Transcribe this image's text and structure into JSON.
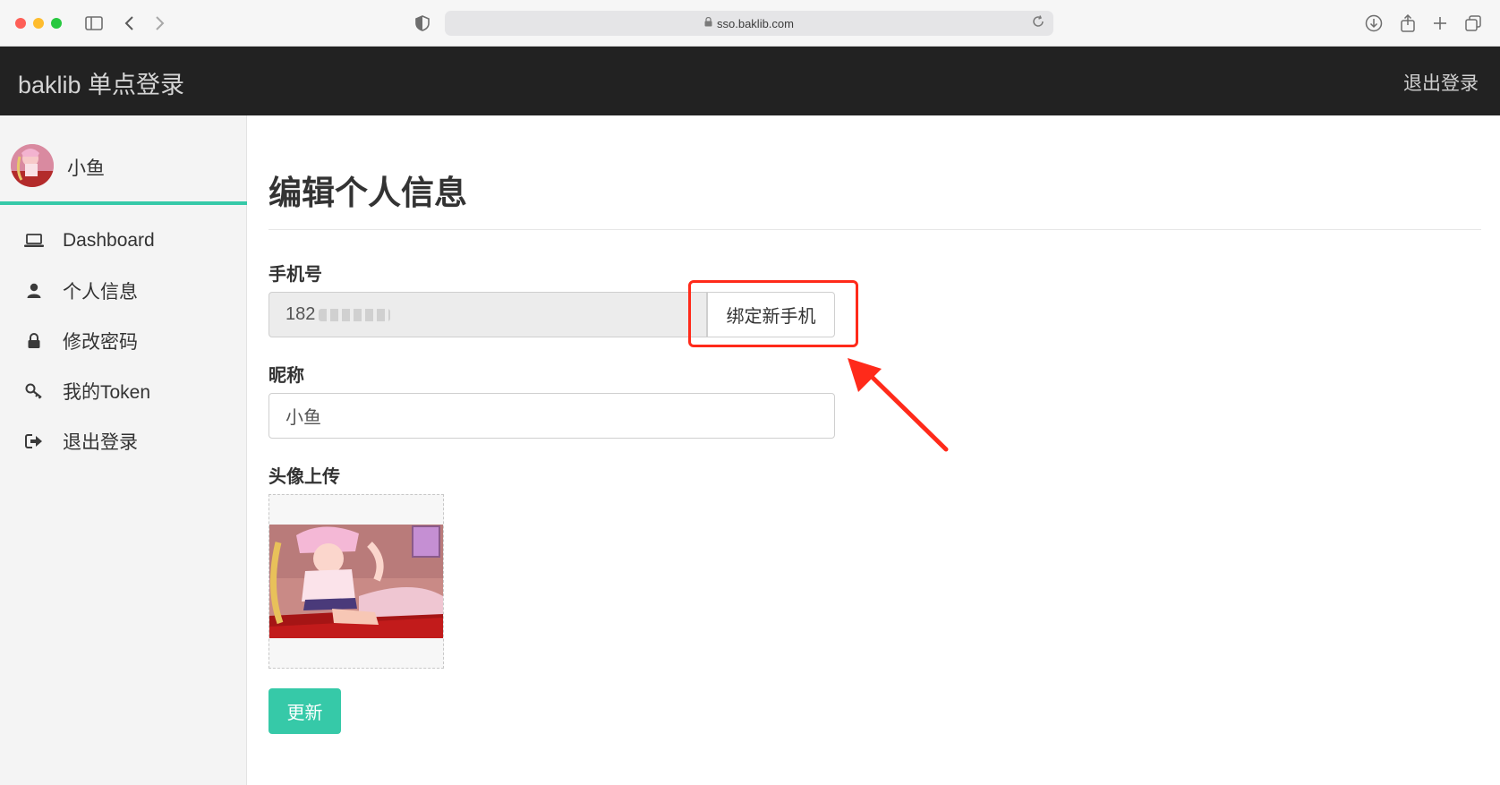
{
  "browser": {
    "url": "sso.baklib.com",
    "icons": [
      "sidebar-toggle-icon",
      "back-icon",
      "forward-icon",
      "privacy-shield-icon",
      "download-icon",
      "share-icon",
      "new-tab-icon",
      "tabs-overview-icon"
    ]
  },
  "header": {
    "brand": "baklib 单点登录",
    "logout_label": "退出登录"
  },
  "sidebar": {
    "user_name": "小鱼",
    "items": [
      {
        "label": "Dashboard",
        "icon": "laptop-icon"
      },
      {
        "label": "个人信息",
        "icon": "user-icon"
      },
      {
        "label": "修改密码",
        "icon": "lock-icon"
      },
      {
        "label": "我的Token",
        "icon": "key-icon"
      },
      {
        "label": "退出登录",
        "icon": "sign-out-icon"
      }
    ]
  },
  "main": {
    "title": "编辑个人信息",
    "phone": {
      "label": "手机号",
      "value": "182",
      "bind_button_label": "绑定新手机"
    },
    "nickname": {
      "label": "昵称",
      "value": "小鱼"
    },
    "avatar_upload": {
      "label": "头像上传"
    },
    "update_button_label": "更新"
  },
  "colors": {
    "accent": "#36c9a8",
    "header_bg": "#222222",
    "annotation": "#ff2a1a"
  }
}
